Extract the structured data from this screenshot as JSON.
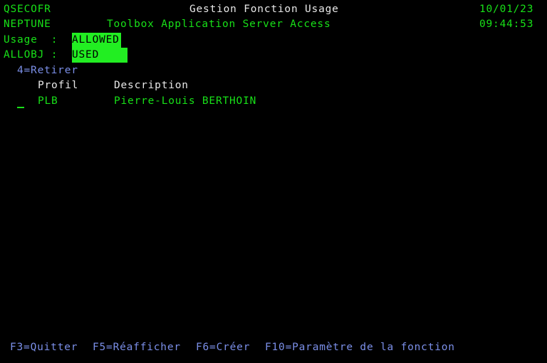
{
  "header": {
    "user": "QSECOFR",
    "system": "NEPTUNE",
    "title": "Gestion Fonction Usage",
    "subtitle": "Toolbox Application Server Access",
    "date": "10/01/23",
    "time": "09:44:53"
  },
  "fields": {
    "usage_label": "Usage  :",
    "usage_value": "ALLOWED",
    "allobj_label": "ALLOBJ :",
    "allobj_value": "USED"
  },
  "options": {
    "retirer": "4=Retirer"
  },
  "table": {
    "columns": [
      "Profil",
      "Description"
    ],
    "rows": [
      {
        "option": "",
        "profil": "PLB",
        "description": "Pierre-Louis BERTHOIN"
      }
    ]
  },
  "function_keys": [
    {
      "key": "F3",
      "label": "F3=Quitter"
    },
    {
      "key": "F5",
      "label": "F5=Réafficher"
    },
    {
      "key": "F6",
      "label": "F6=Créer"
    },
    {
      "key": "F10",
      "label": "F10=Paramètre de la fonction"
    }
  ],
  "colors": {
    "background": "#000000",
    "green": "#18e018",
    "white": "#e8e8e8",
    "blue": "#7b8fe8",
    "field_highlight": "#22ee22"
  }
}
